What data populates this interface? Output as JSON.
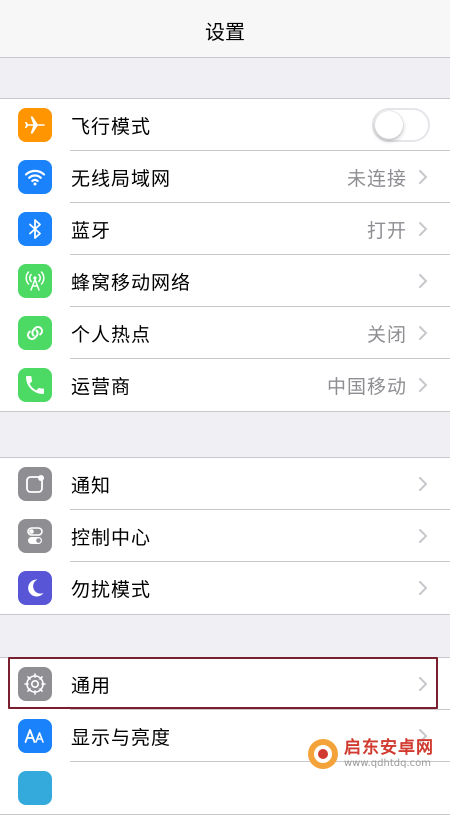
{
  "nav": {
    "title": "设置"
  },
  "colors": {
    "airplane": "#ff9500",
    "wifi": "#1a82fb",
    "bluetooth": "#1a82fb",
    "cellular": "#4cd964",
    "hotspot": "#4cd964",
    "carrier": "#4cd964",
    "notifications": "#8e8e93",
    "control_center": "#8e8e93",
    "dnd": "#5856d6",
    "general": "#8e8e93",
    "display": "#1a82fb",
    "highlight": "#7a1f2e"
  },
  "groups": [
    {
      "items": [
        {
          "label": "飞行模式",
          "icon": "airplane-icon",
          "toggle": true,
          "toggle_on": false
        },
        {
          "label": "无线局域网",
          "icon": "wifi-icon",
          "value": "未连接"
        },
        {
          "label": "蓝牙",
          "icon": "bluetooth-icon",
          "value": "打开"
        },
        {
          "label": "蜂窝移动网络",
          "icon": "cellular-antenna-icon",
          "value": ""
        },
        {
          "label": "个人热点",
          "icon": "hotspot-link-icon",
          "value": "关闭"
        },
        {
          "label": "运营商",
          "icon": "phone-icon",
          "value": "中国移动"
        }
      ]
    },
    {
      "items": [
        {
          "label": "通知",
          "icon": "notifications-icon"
        },
        {
          "label": "控制中心",
          "icon": "control-center-icon"
        },
        {
          "label": "勿扰模式",
          "icon": "moon-icon"
        }
      ]
    },
    {
      "items": [
        {
          "label": "通用",
          "icon": "gear-icon",
          "highlighted": true
        },
        {
          "label": "显示与亮度",
          "icon": "text-size-icon"
        }
      ]
    }
  ],
  "watermark": {
    "main": "启东安卓网",
    "sub": "www.qdhtdq.com"
  }
}
